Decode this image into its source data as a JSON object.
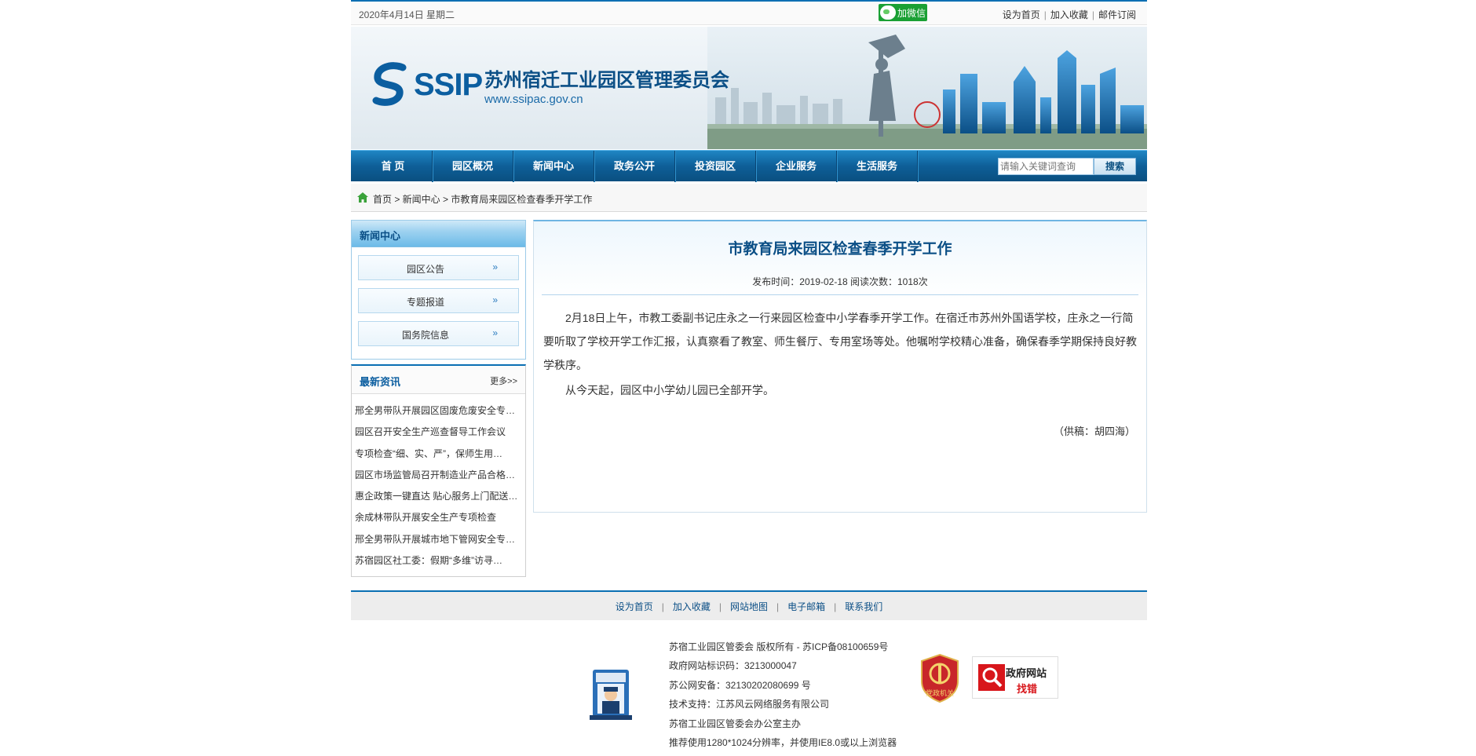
{
  "topbar": {
    "date": "2020年4月14日 星期二",
    "wechat_label": "加微信",
    "links": [
      "设为首页",
      "加入收藏",
      "邮件订阅"
    ]
  },
  "banner": {
    "logo_text": "SSIP",
    "org_name": "苏州宿迁工业园区管理委员会",
    "url": "www.ssipac.gov.cn"
  },
  "nav": {
    "items": [
      "首 页",
      "园区概况",
      "新闻中心",
      "政务公开",
      "投资园区",
      "企业服务",
      "生活服务"
    ],
    "search_placeholder": "请输入关键词查询",
    "search_button": "搜索"
  },
  "breadcrumb": "首页 > 新闻中心 > 市教育局来园区检查春季开学工作",
  "sidebar": {
    "title": "新闻中心",
    "items": [
      {
        "label": "园区公告",
        "arrow": "»"
      },
      {
        "label": "专题报道",
        "arrow": "»"
      },
      {
        "label": "国务院信息",
        "arrow": "»"
      }
    ]
  },
  "latest": {
    "title": "最新资讯",
    "more": "更多>>",
    "items": [
      "邢全男带队开展园区固废危废安全专…",
      "园区召开安全生产巡查督导工作会议",
      "专项检查“细、实、严”，保师生用…",
      "园区市场监管局召开制造业产品合格…",
      "惠企政策一键直达 贴心服务上门配送…",
      "余成林带队开展安全生产专项检查",
      "邢全男带队开展城市地下管网安全专…",
      "苏宿园区社工委：假期“多维”访寻…"
    ]
  },
  "article": {
    "title": "市教育局来园区检查春季开学工作",
    "meta": "发布时间：2019-02-18 阅读次数：1018次",
    "paragraphs": [
      "2月18日上午，市教工委副书记庄永之一行来园区检查中小学春季开学工作。在宿迁市苏州外国语学校，庄永之一行简要听取了学校开学工作汇报，认真察看了教室、师生餐厅、专用室场等处。他嘱咐学校精心准备，确保春季学期保持良好教学秩序。",
      "从今天起，园区中小学幼儿园已全部开学。"
    ],
    "source": "（供稿：胡四海）"
  },
  "footer": {
    "links": [
      "设为首页",
      "加入收藏",
      "网站地图",
      "电子邮箱",
      "联系我们"
    ],
    "info": [
      "苏宿工业园区管委会  版权所有 - 苏ICP备08100659号",
      "政府网站标识码：3213000047",
      "苏公网安备：32130202080699 号",
      "技术支持：江苏风云网络服务有限公司",
      "苏宿工业园区管委会办公室主办",
      "推荐使用1280*1024分辨率，并使用IE8.0或以上浏览器"
    ],
    "badge_party": "党政机关",
    "badge_gov_line1": "政府网站",
    "badge_gov_line2": "找错"
  },
  "colors": {
    "nav_blue": "#0e5f98",
    "title_blue": "#0b4f86",
    "accent": "#0a6fb3",
    "wechat_green": "#1aa034",
    "error_red": "#d8161b"
  }
}
